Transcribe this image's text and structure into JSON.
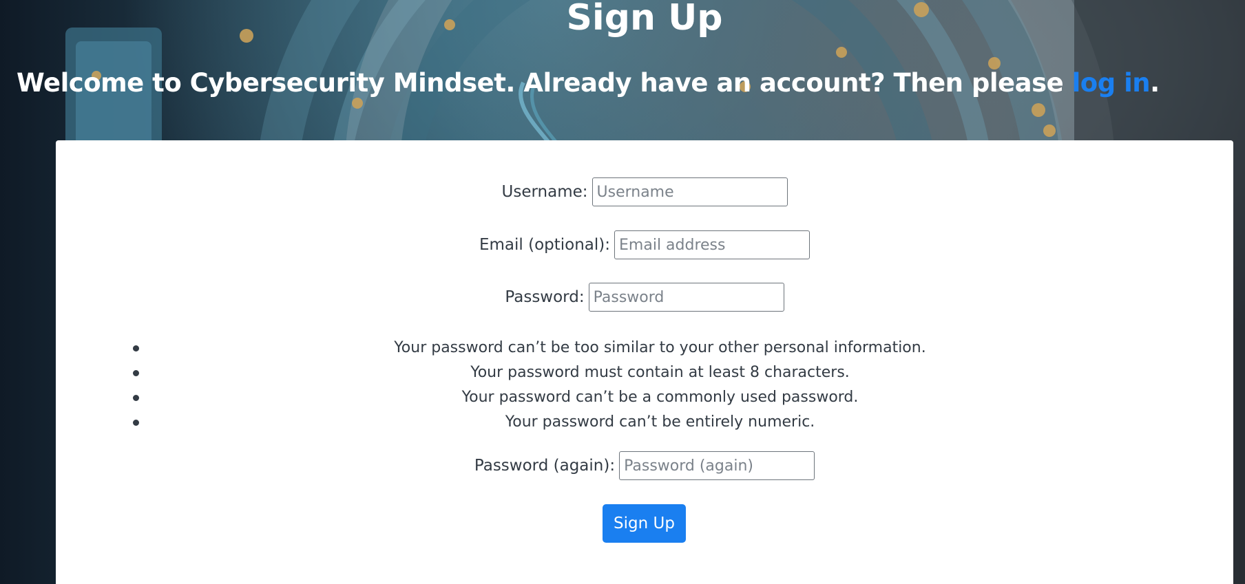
{
  "header": {
    "title": "Sign Up",
    "welcome_text": "Welcome to Cybersecurity Mindset. Already have an account? Then please ",
    "login_link": "log in",
    "welcome_suffix": "."
  },
  "form": {
    "username": {
      "label": "Username:",
      "placeholder": "Username",
      "value": ""
    },
    "email": {
      "label": "Email (optional):",
      "placeholder": "Email address",
      "value": ""
    },
    "password": {
      "label": "Password:",
      "placeholder": "Password",
      "value": ""
    },
    "password_hints": [
      "Your password can’t be too similar to your other personal information.",
      "Your password must contain at least 8 characters.",
      "Your password can’t be a commonly used password.",
      "Your password can’t be entirely numeric."
    ],
    "password_again": {
      "label": "Password (again):",
      "placeholder": "Password (again)",
      "value": ""
    },
    "submit_label": "Sign Up"
  },
  "colors": {
    "accent": "#1a7ff0",
    "card_bg": "#ffffff",
    "text": "#333b44"
  }
}
